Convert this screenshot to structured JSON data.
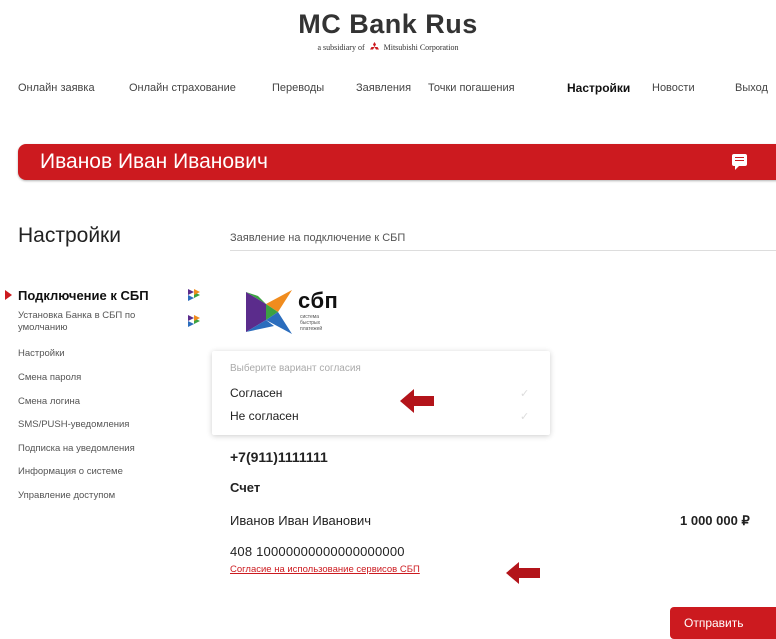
{
  "brand": {
    "title": "MC Bank Rus",
    "subtitle_prefix": "a subsidiary of",
    "subtitle_company": "Mitsubishi Corporation"
  },
  "nav": [
    {
      "label": "Онлайн заявка",
      "active": false
    },
    {
      "label": "Онлайн страхование",
      "active": false
    },
    {
      "label": "Переводы",
      "active": false
    },
    {
      "label": "Заявления",
      "active": false
    },
    {
      "label": "Точки погашения",
      "active": false
    },
    {
      "label": "Настройки",
      "active": true
    },
    {
      "label": "Новости",
      "active": false
    },
    {
      "label": "Выход",
      "active": false
    }
  ],
  "banner": {
    "user_name": "Иванов Иван Иванович",
    "icon": "chat-icon"
  },
  "settings": {
    "title": "Настройки",
    "breadcrumb": "Заявление на подключение к СБП"
  },
  "sidebar": {
    "active_item": "Подключение к СБП",
    "items": [
      "Установка Банка в СБП по умолчанию",
      "Настройки",
      "Смена пароля",
      "Смена логина",
      "SMS/PUSH-уведомления",
      "Подписка на уведомления",
      "Информация о системе",
      "Управление доступом"
    ]
  },
  "sbp_logo": {
    "name": "сбп",
    "tagline_line1": "система быстрых",
    "tagline_line2": "платежей"
  },
  "consent_dropdown": {
    "placeholder": "Выберите вариант согласия",
    "options": [
      "Согласен",
      "Не согласен"
    ]
  },
  "account": {
    "phone": "+7(911)1111111",
    "label": "Счет",
    "owner": "Иванов Иван Иванович",
    "amount": "1 000 000 ₽",
    "number": "408 10000000000000000000",
    "consent_link": "Согласие на использование сервисов СБП"
  },
  "actions": {
    "submit": "Отправить"
  },
  "colors": {
    "accent": "#cc1a1f",
    "sbp_green": "#3ca142",
    "sbp_blue": "#2b6dbd",
    "sbp_purple": "#5b2c8c",
    "sbp_orange": "#f08c1e"
  }
}
